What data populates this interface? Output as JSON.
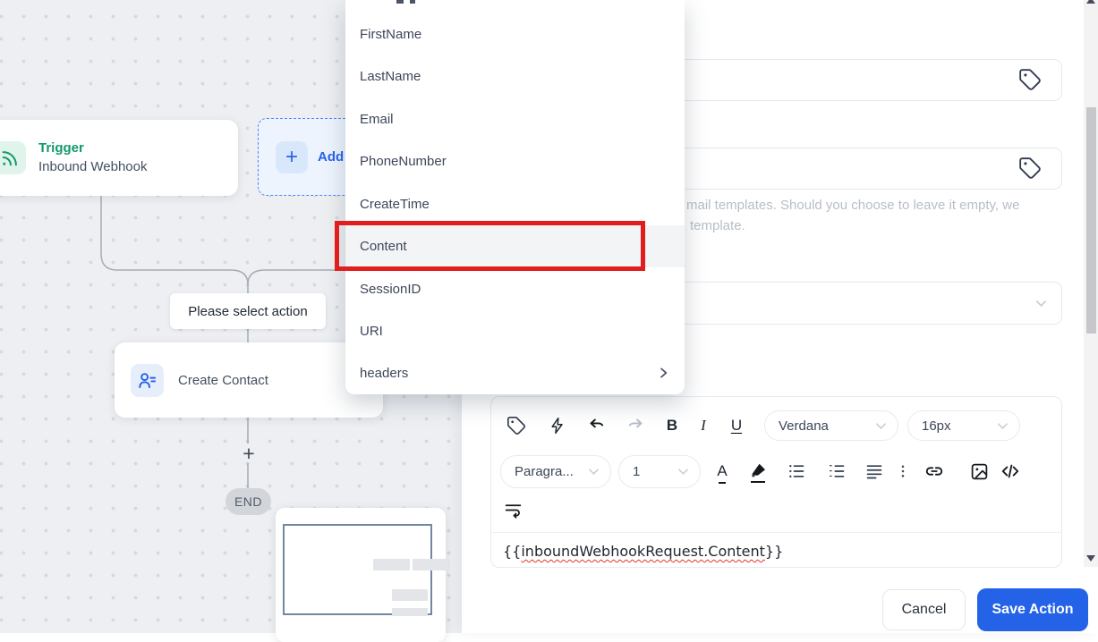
{
  "canvas": {
    "trigger_node": {
      "title": "Trigger",
      "subtitle": "Inbound Webhook"
    },
    "add_button": {
      "plus": "+",
      "label": "Add"
    },
    "action_prompt": "Please select action",
    "create_contact_node": {
      "label": "Create Contact"
    },
    "plus_connector": "+",
    "end_label": "END"
  },
  "dropdown": {
    "items": [
      {
        "label": "FirstName"
      },
      {
        "label": "LastName"
      },
      {
        "label": "Email"
      },
      {
        "label": "PhoneNumber"
      },
      {
        "label": "CreateTime"
      },
      {
        "label": "Content"
      },
      {
        "label": "SessionID"
      },
      {
        "label": "URI"
      },
      {
        "label": "headers"
      }
    ],
    "highlighted_item": "Content"
  },
  "panel": {
    "help_text_line1": "mail templates. Should you choose to leave it empty, we",
    "help_text_line2": "template.",
    "editor": {
      "bold_label": "B",
      "italic_label": "I",
      "underline_label": "U",
      "font_color_label": "A",
      "font_family_value": "Verdana",
      "font_size_value": "16px",
      "paragraph_value": "Paragra...",
      "line_height_value": "1",
      "content_open": "{{",
      "content_token": "inboundWebhookRequest.Content",
      "content_close": "}}"
    },
    "buttons": {
      "cancel": "Cancel",
      "save": "Save Action"
    }
  },
  "colors": {
    "accent_blue": "#2463e8",
    "trigger_green": "#12996f",
    "annotation_red": "#e11d1d",
    "canvas_bg": "#edeff2",
    "end_pill_bg": "#d2d5da",
    "help_text": "#b7bec8"
  }
}
